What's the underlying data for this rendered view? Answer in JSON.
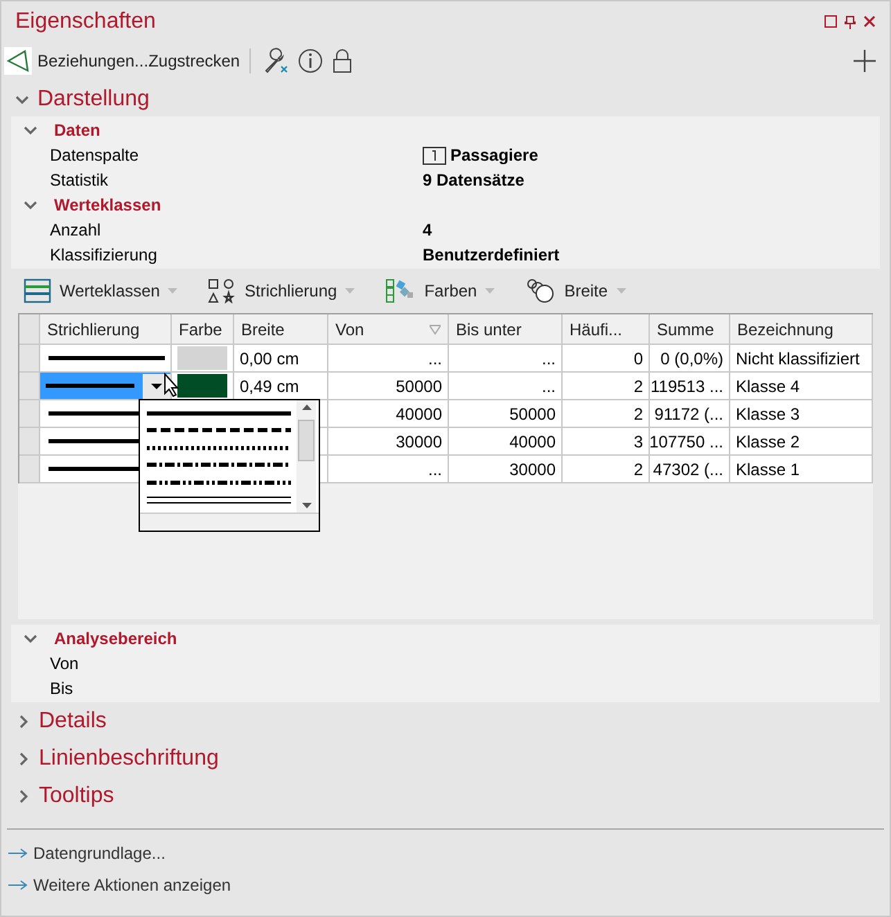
{
  "panel": {
    "title": "Eigenschaften"
  },
  "toolbar": {
    "object_label": "Beziehungen...Zugstrecken"
  },
  "sections_top": [
    {
      "title": "Darstellung",
      "expanded": true
    }
  ],
  "groups": [
    {
      "title": "Daten",
      "expanded": true,
      "rows": [
        {
          "label": "Datenspalte",
          "value": "Passagiere",
          "kind": "column"
        },
        {
          "label": "Statistik",
          "value": "9 Datensätze",
          "kind": "plain"
        }
      ]
    },
    {
      "title": "Werteklassen",
      "expanded": true,
      "rows": [
        {
          "label": "Anzahl",
          "value": "4",
          "kind": "plain"
        },
        {
          "label": "Klassifizierung",
          "value": "Benutzerdefiniert",
          "kind": "plain"
        }
      ]
    }
  ],
  "table_toolbar": [
    "Werteklassen",
    "Strichlierung",
    "Farben",
    "Breite"
  ],
  "table": {
    "columns": [
      "Strichlierung",
      "Farbe",
      "Breite",
      "Von",
      "Bis unter",
      "Häufi...",
      "Summe",
      "Bezeichnung"
    ],
    "rows": [
      {
        "selected": false,
        "color": "#d4d4d4",
        "breite": "0,00 cm",
        "von": "...",
        "bis": "...",
        "haeufigkeit": "0",
        "summe": "0 (0,0%)",
        "bezeichnung": "Nicht klassifiziert"
      },
      {
        "selected": true,
        "color": "#004d26",
        "breite": "0,49 cm",
        "von": "50000",
        "bis": "...",
        "haeufigkeit": "2",
        "summe": "119513 ...",
        "bezeichnung": "Klasse 4"
      },
      {
        "selected": false,
        "von": "40000",
        "bis": "50000",
        "haeufigkeit": "2",
        "summe": "91172 (...",
        "bezeichnung": "Klasse 3"
      },
      {
        "selected": false,
        "von": "30000",
        "bis": "40000",
        "haeufigkeit": "3",
        "summe": "107750 ...",
        "bezeichnung": "Klasse 2"
      },
      {
        "selected": false,
        "von": "...",
        "bis": "30000",
        "haeufigkeit": "2",
        "summe": "47302 (...",
        "bezeichnung": "Klasse 1"
      }
    ]
  },
  "dash_dropdown": {
    "options": [
      {
        "kind": "solid"
      },
      {
        "kind": "dash"
      },
      {
        "kind": "dot"
      },
      {
        "kind": "dashdot"
      },
      {
        "kind": "dashdotdot"
      },
      {
        "kind": "double"
      }
    ]
  },
  "analysis": {
    "title": "Analysebereich",
    "expanded": true,
    "rows": [
      "Von",
      "Bis"
    ]
  },
  "sections_bottom": [
    {
      "title": "Details",
      "expanded": false
    },
    {
      "title": "Linienbeschriftung",
      "expanded": false
    },
    {
      "title": "Tooltips",
      "expanded": false
    }
  ],
  "links": [
    "Datengrundlage...",
    "Weitere Aktionen anzeigen"
  ]
}
